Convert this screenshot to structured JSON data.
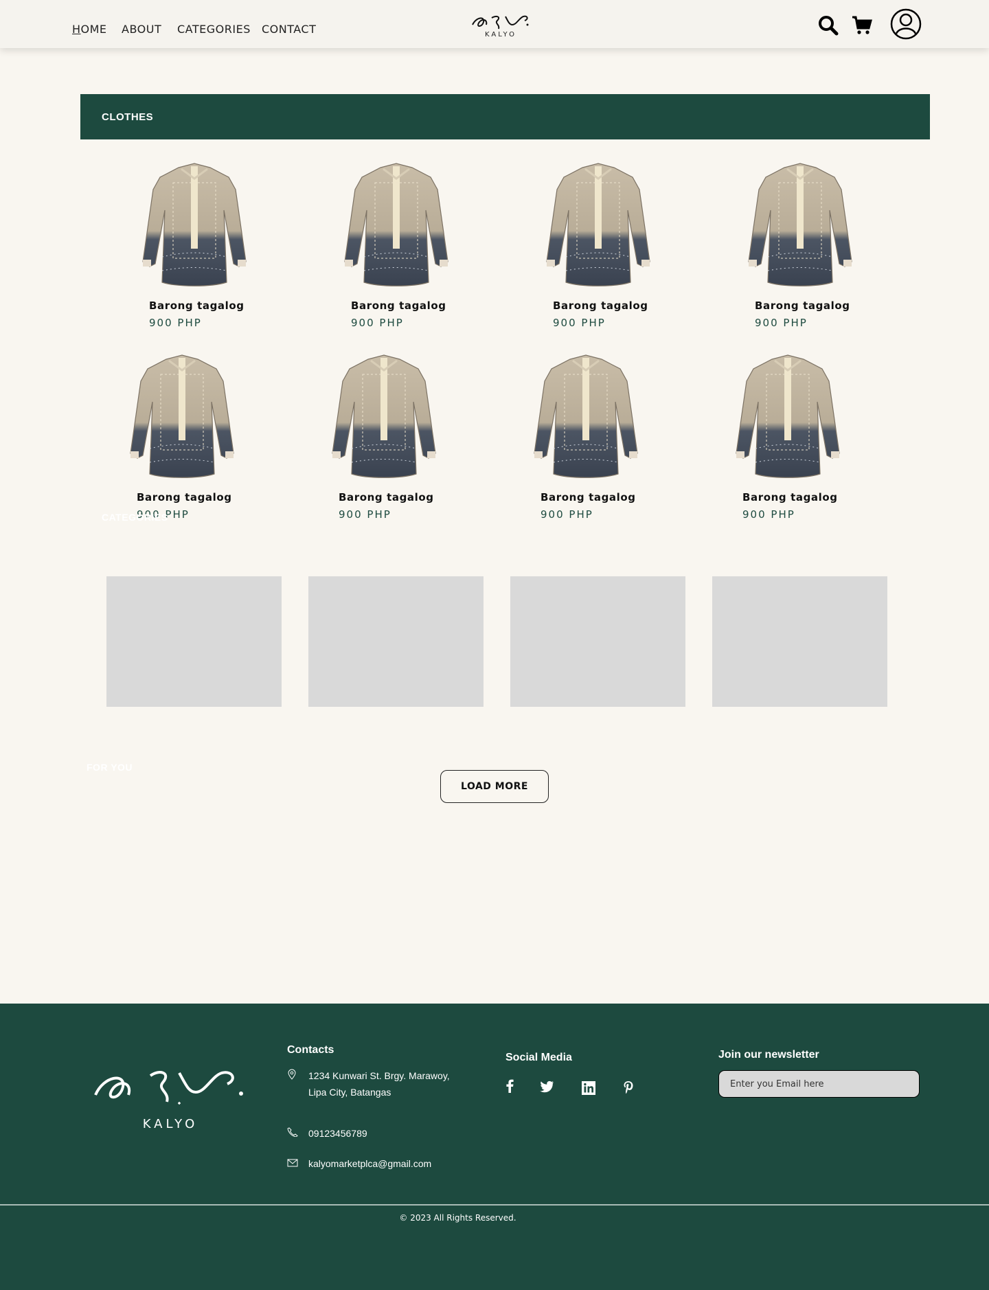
{
  "nav": {
    "links": [
      "HOME",
      "ABOUT",
      "CATEGORIES",
      "CONTACT"
    ],
    "logo_text": "KALYO",
    "icons": [
      "search-icon",
      "cart-icon",
      "user-icon"
    ]
  },
  "section": {
    "title": "CLOTHES",
    "ghost_categories": "CATEGORIES",
    "ghost_for_you": "FOR YOU"
  },
  "products": [
    {
      "name": "Barong tagalog",
      "price": "900 PHP"
    },
    {
      "name": "Barong tagalog",
      "price": "900 PHP"
    },
    {
      "name": "Barong tagalog",
      "price": "900 PHP"
    },
    {
      "name": "Barong tagalog",
      "price": "900 PHP"
    },
    {
      "name": "Barong tagalog",
      "price": "900 PHP"
    },
    {
      "name": "Barong tagalog",
      "price": "900 PHP"
    },
    {
      "name": "Barong tagalog",
      "price": "900 PHP"
    },
    {
      "name": "Barong tagalog",
      "price": "900 PHP"
    }
  ],
  "load_more": "LOAD MORE",
  "footer": {
    "logo_text": "KALYO",
    "contacts_title": "Contacts",
    "address_line1": "1234 Kunwari St. Brgy. Marawoy,",
    "address_line2": "Lipa City, Batangas",
    "phone": "09123456789",
    "email": "kalyomarketplca@gmail.com",
    "social_title": "Social Media",
    "social_icons": [
      "facebook-icon",
      "twitter-icon",
      "linkedin-icon",
      "pinterest-icon"
    ],
    "newsletter_title": "Join our newsletter",
    "newsletter_placeholder": "Enter you Email here",
    "copyright": "© 2023 All Rights Reserved."
  },
  "colors": {
    "brand_green": "#1d4a3f",
    "page_bg": "#f9f6f0",
    "tile_gray": "#d9d9d9"
  }
}
